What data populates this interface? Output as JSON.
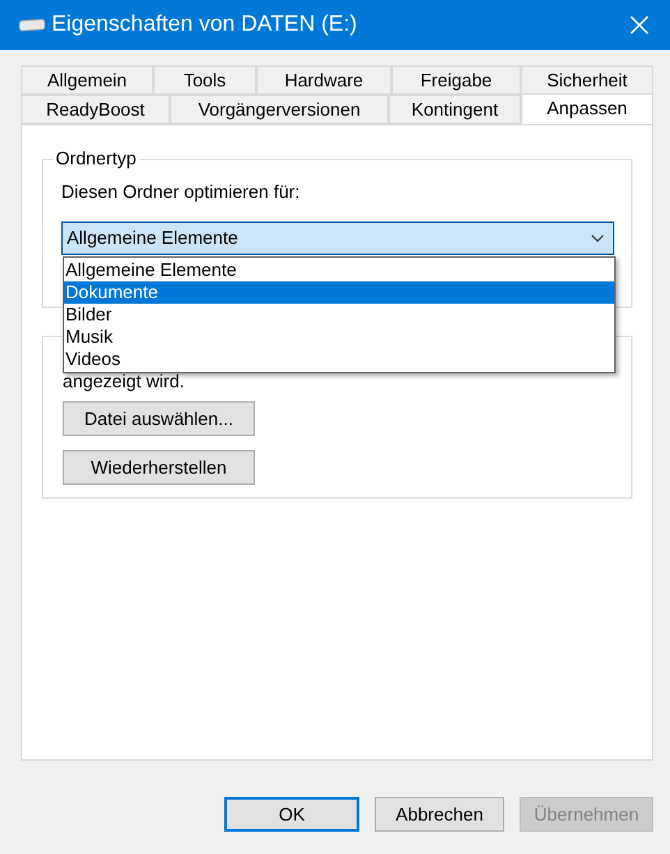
{
  "window": {
    "title": "Eigenschaften von DATEN (E:)"
  },
  "tab_rows": [
    [
      {
        "label": "Allgemein",
        "selected": false
      },
      {
        "label": "Tools",
        "selected": false
      },
      {
        "label": "Hardware",
        "selected": false
      },
      {
        "label": "Freigabe",
        "selected": false
      },
      {
        "label": "Sicherheit",
        "selected": false
      }
    ],
    [
      {
        "label": "ReadyBoost",
        "selected": false
      },
      {
        "label": "Vorgängerversionen",
        "selected": false
      },
      {
        "label": "Kontingent",
        "selected": false
      },
      {
        "label": "Anpassen",
        "selected": true
      }
    ]
  ],
  "folder_type": {
    "title": "Ordnertyp",
    "label": "Diesen Ordner optimieren für:",
    "combo_value": "Allgemeine Elemente",
    "expanded": true,
    "options": [
      {
        "label": "Allgemeine Elemente",
        "selected": false
      },
      {
        "label": "Dokumente",
        "selected": true
      },
      {
        "label": "Bilder",
        "selected": false
      },
      {
        "label": "Musik",
        "selected": false
      },
      {
        "label": "Videos",
        "selected": false
      }
    ]
  },
  "folder_picture": {
    "text": "angezeigt wird.",
    "buttons": [
      "Datei auswählen...",
      "Wiederherstellen"
    ]
  },
  "buttons": [
    {
      "label": "OK",
      "kind": "default",
      "disabled": false
    },
    {
      "label": "Abbrechen",
      "kind": "normal",
      "disabled": false
    },
    {
      "label": "Übernehmen",
      "kind": "normal",
      "disabled": true
    }
  ]
}
